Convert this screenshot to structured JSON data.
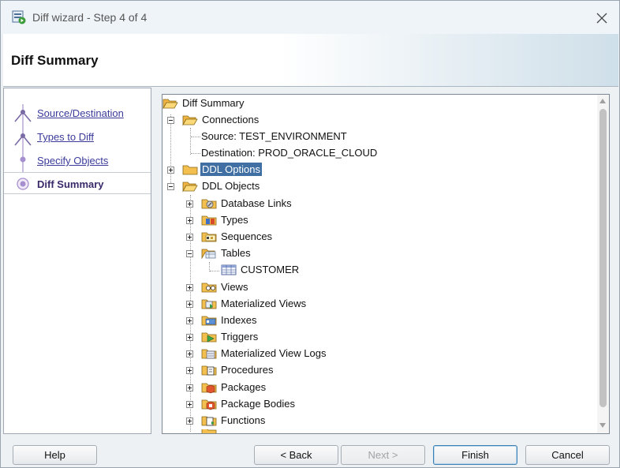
{
  "window": {
    "title": "Diff wizard - Step 4 of 4",
    "close_glyph": "✕"
  },
  "header": {
    "title": "Diff Summary"
  },
  "nav": {
    "items": [
      {
        "label": "Source/Destination"
      },
      {
        "label": "Types to Diff"
      },
      {
        "label": "Specify Objects"
      },
      {
        "label": "Diff Summary",
        "active": true
      }
    ]
  },
  "tree": {
    "root": "Diff Summary",
    "connections": "Connections",
    "source": "Source: TEST_ENVIRONMENT",
    "destination": "Destination: PROD_ORACLE_CLOUD",
    "ddl_options": "DDL Options",
    "ddl_objects": "DDL Objects",
    "children": [
      {
        "label": "Database Links",
        "icon": "database-link-icon"
      },
      {
        "label": "Types",
        "icon": "type-icon"
      },
      {
        "label": "Sequences",
        "icon": "sequence-icon"
      },
      {
        "label": "Tables",
        "icon": "table-folder-icon"
      },
      {
        "label": "CUSTOMER",
        "icon": "table-icon"
      },
      {
        "label": "Views",
        "icon": "view-icon"
      },
      {
        "label": "Materialized Views",
        "icon": "materialized-view-icon"
      },
      {
        "label": "Indexes",
        "icon": "index-icon"
      },
      {
        "label": "Triggers",
        "icon": "trigger-icon"
      },
      {
        "label": "Materialized View Logs",
        "icon": "mview-log-icon"
      },
      {
        "label": "Procedures",
        "icon": "procedure-icon"
      },
      {
        "label": "Packages",
        "icon": "package-icon"
      },
      {
        "label": "Package Bodies",
        "icon": "package-body-icon"
      },
      {
        "label": "Functions",
        "icon": "function-icon"
      }
    ]
  },
  "buttons": {
    "help": "Help",
    "back": "< Back",
    "next": "Next >",
    "finish": "Finish",
    "cancel": "Cancel"
  },
  "colors": {
    "selection": "#3f6fa3",
    "nav_link": "#3b3b9b",
    "folder": "#f0b542"
  }
}
